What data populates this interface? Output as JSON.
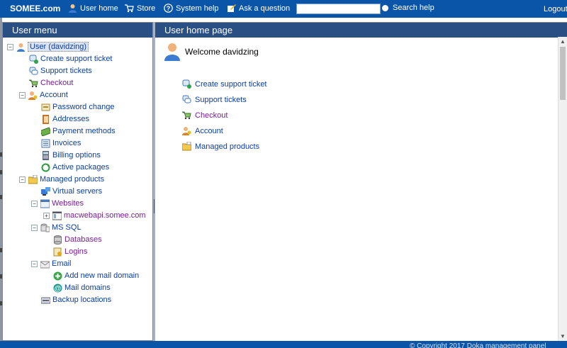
{
  "topbar": {
    "brand": "SOMEE.com",
    "nav": [
      {
        "label": "User home",
        "icon": "user-icon"
      },
      {
        "label": "Store",
        "icon": "cart-icon"
      },
      {
        "label": "System help",
        "icon": "help-icon"
      },
      {
        "label": "Ask a question",
        "icon": "edit-icon"
      }
    ],
    "search_value": "",
    "search_label": "Search help",
    "logout": "Logout"
  },
  "left_panel": {
    "title": "User menu",
    "tree": [
      {
        "label": "User (davidzing)",
        "icon": "user-icon",
        "expander": "−",
        "selected": true
      },
      {
        "label": "Create support ticket",
        "icon": "new-ticket-icon"
      },
      {
        "label": "Support tickets",
        "icon": "tickets-icon"
      },
      {
        "label": "Checkout",
        "icon": "cart-icon",
        "visited": true
      },
      {
        "label": "Account",
        "icon": "account-icon",
        "expander": "−"
      },
      {
        "label": "Password change",
        "icon": "password-icon"
      },
      {
        "label": "Addresses",
        "icon": "address-book-icon"
      },
      {
        "label": "Payment methods",
        "icon": "payment-icon"
      },
      {
        "label": "Invoices",
        "icon": "invoice-icon"
      },
      {
        "label": "Billing options",
        "icon": "calculator-icon"
      },
      {
        "label": "Active packages",
        "icon": "refresh-icon"
      },
      {
        "label": "Managed products",
        "icon": "folder-icon",
        "expander": "−"
      },
      {
        "label": "Virtual servers",
        "icon": "server-icon"
      },
      {
        "label": "Websites",
        "icon": "website-icon",
        "expander": "−",
        "visited": true
      },
      {
        "label": "macwebapi.somee.com",
        "icon": "webpage-icon",
        "expander": "+",
        "visited": true
      },
      {
        "label": "MS SQL",
        "icon": "sql-icon",
        "expander": "−"
      },
      {
        "label": "Databases",
        "icon": "database-icon",
        "visited": true
      },
      {
        "label": "Logins",
        "icon": "login-icon",
        "visited": true
      },
      {
        "label": "Email",
        "icon": "email-icon",
        "expander": "−"
      },
      {
        "label": "Add new mail domain",
        "icon": "add-icon"
      },
      {
        "label": "Mail domains",
        "icon": "at-icon"
      },
      {
        "label": "Backup locations",
        "icon": "backup-icon"
      }
    ]
  },
  "right_panel": {
    "title": "User home page",
    "welcome": "Welcome davidzing",
    "links": [
      {
        "label": "Create support ticket",
        "icon": "new-ticket-icon"
      },
      {
        "label": "Support tickets",
        "icon": "tickets-icon"
      },
      {
        "label": "Checkout",
        "icon": "cart-icon",
        "visited": true
      },
      {
        "label": "Account",
        "icon": "account-icon"
      },
      {
        "label": "Managed products",
        "icon": "folder-icon"
      }
    ]
  },
  "footer": {
    "text": "© Copyright 2017 Doka management panel"
  },
  "colors": {
    "header_blue": "#0a55a8",
    "panel_head": "#2a4f84",
    "link": "#0a3ea0",
    "visited": "#7d1b9c"
  }
}
